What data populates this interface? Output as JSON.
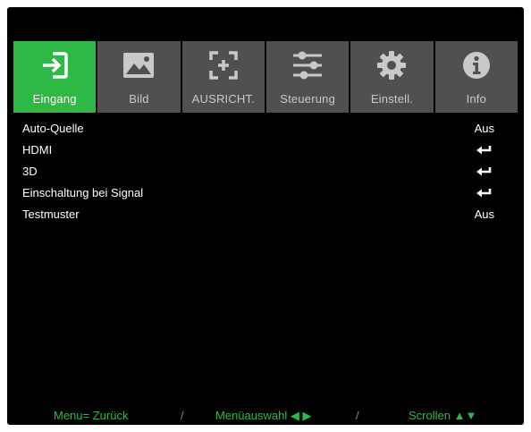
{
  "tabs": [
    {
      "label": "Eingang",
      "icon": "input-arrow-icon",
      "active": true
    },
    {
      "label": "Bild",
      "icon": "image-icon",
      "active": false
    },
    {
      "label": "AUSRICHT.",
      "icon": "alignment-frame-icon",
      "active": false
    },
    {
      "label": "Steuerung",
      "icon": "sliders-icon",
      "active": false
    },
    {
      "label": "Einstell.",
      "icon": "gear-icon",
      "active": false
    },
    {
      "label": "Info",
      "icon": "info-icon",
      "active": false
    }
  ],
  "menu": {
    "items": [
      {
        "label": "Auto-Quelle",
        "value": "Aus"
      },
      {
        "label": "HDMI",
        "value": "enter-icon"
      },
      {
        "label": "3D",
        "value": "enter-icon"
      },
      {
        "label": "Einschaltung bei Signal",
        "value": "enter-icon"
      },
      {
        "label": "Testmuster",
        "value": "Aus"
      }
    ]
  },
  "footer": {
    "back": "Menu= Zurück",
    "separator": "/",
    "select": "Menüauswahl ◀ ▶",
    "scroll": "Scrollen ▲▼"
  },
  "colors": {
    "accent": "#2eb845",
    "tab_inactive": "#505050",
    "background": "#000000"
  }
}
